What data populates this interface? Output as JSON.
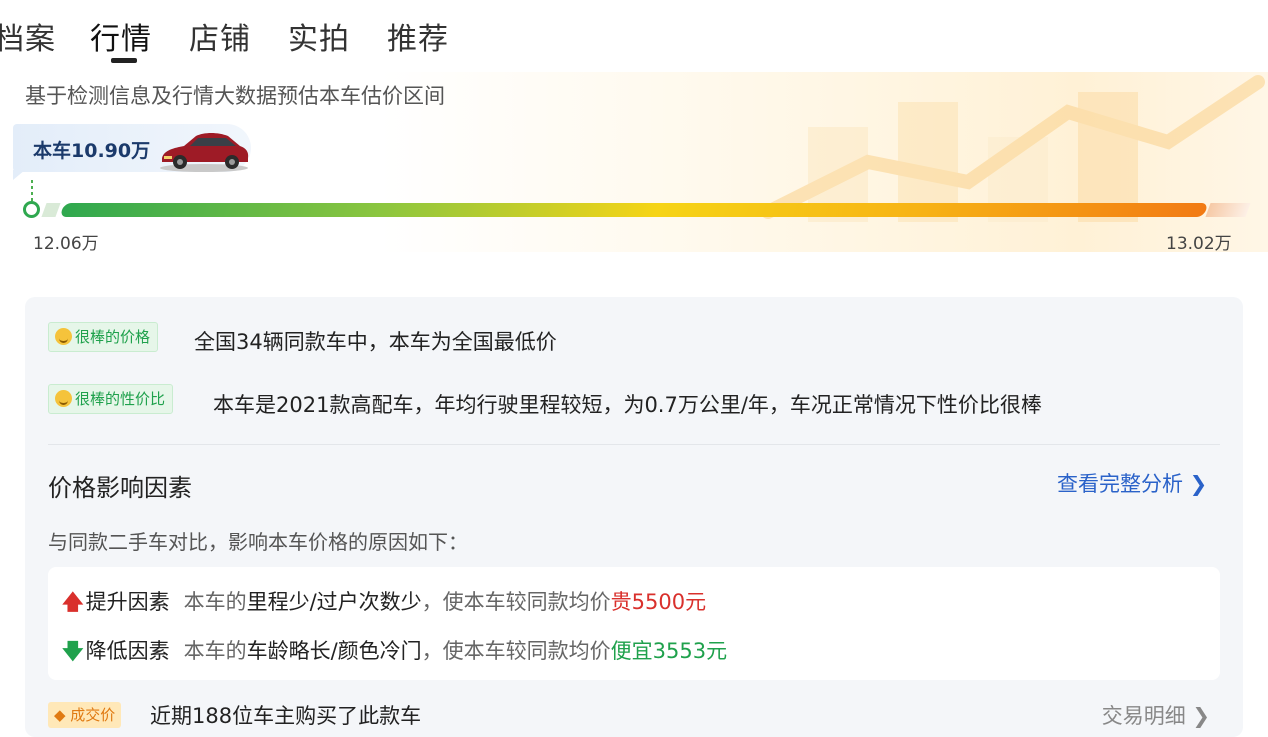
{
  "tabs": [
    {
      "label": "档案"
    },
    {
      "label": "行情",
      "active": true
    },
    {
      "label": "店铺"
    },
    {
      "label": "实拍"
    },
    {
      "label": "推荐"
    }
  ],
  "estimate": {
    "subtitle": "基于检测信息及行情大数据预估本车估价区间",
    "car_price_label": "本车10.90万",
    "range_min": "12.06万",
    "range_max": "13.02万"
  },
  "highlights": [
    {
      "tag": "很棒的价格",
      "text": "全国34辆同款车中，本车为全国最低价"
    },
    {
      "tag": "很棒的性价比",
      "text": "本车是2021款高配车，年均行驶里程较短，为0.7万公里/年，车况正常情况下性价比很棒"
    }
  ],
  "factors": {
    "title": "价格影响因素",
    "link": "查看完整分析 ❯",
    "desc": "与同款二手车对比，影响本车价格的原因如下：",
    "up": {
      "arrow": "🡅",
      "label": "提升因素",
      "prefix": "本车的",
      "items": "里程少/过户次数少",
      "middle": "，使本车较同款均价",
      "result": "贵5500元"
    },
    "down": {
      "arrow": "🡇",
      "label": "降低因素",
      "prefix": "本车的",
      "items": "车龄略长/颜色冷门",
      "middle": "，使本车较同款均价",
      "result": "便宜3553元"
    }
  },
  "partial_row": {
    "tag": "◆ 成交价",
    "text": "近期188位车主购买了此款车",
    "link": "交易明细 ❯"
  },
  "colors": {
    "accent_blue": "#2a62c9",
    "up_red": "#d9302c",
    "down_green": "#1fa14c",
    "gauge_start": "#2fa84f",
    "gauge_end": "#f27a14"
  }
}
